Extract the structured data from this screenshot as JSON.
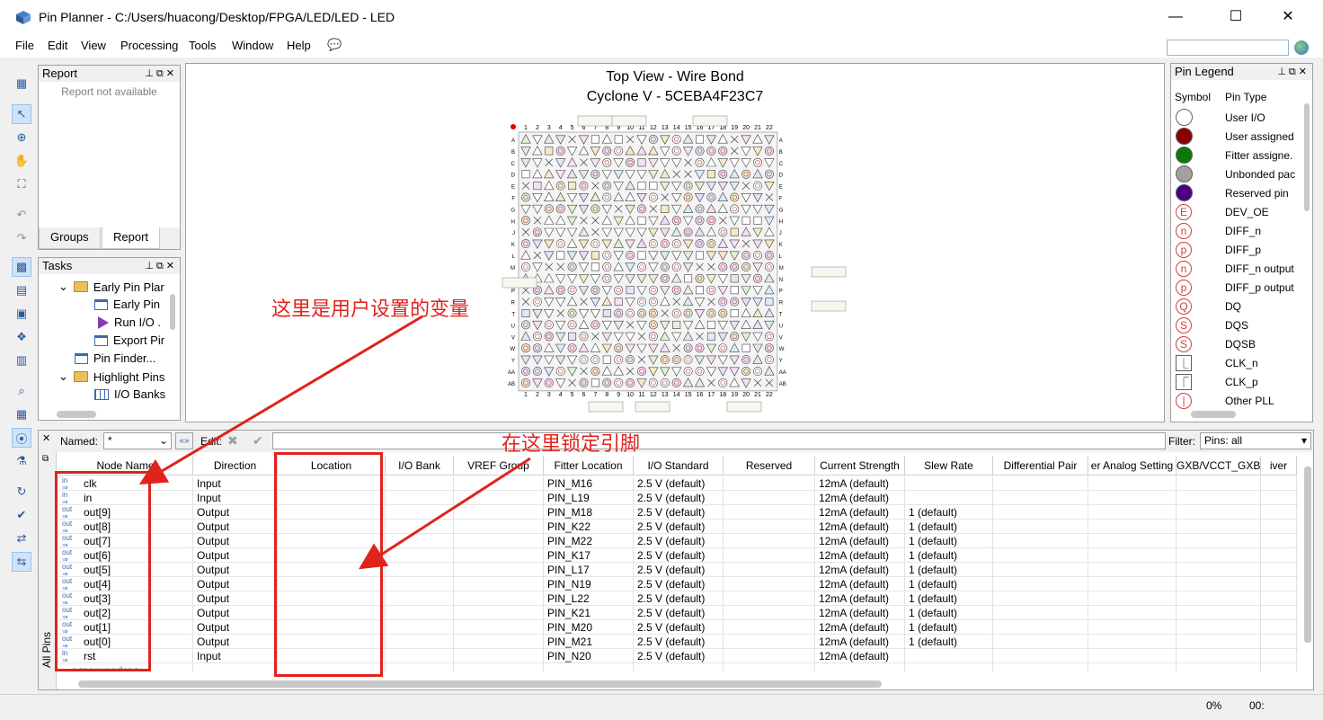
{
  "window": {
    "title": "Pin Planner - C:/Users/huacong/Desktop/FPGA/LED/LED - LED",
    "controls": {
      "minimize": "—",
      "maximize": "☐",
      "close": "✕"
    }
  },
  "menu": [
    "File",
    "Edit",
    "View",
    "Processing",
    "Tools",
    "Window",
    "Help"
  ],
  "report_panel": {
    "title": "Report",
    "message": "Report not available",
    "tabs": [
      "Groups",
      "Report"
    ]
  },
  "tasks_panel": {
    "title": "Tasks",
    "items": [
      "Early Pin Plar",
      "Early Pin",
      "Run I/O .",
      "Export Pir",
      "Pin Finder...",
      "Highlight Pins",
      "I/O Banks"
    ]
  },
  "chip_view": {
    "title_line1": "Top View - Wire Bond",
    "title_line2": "Cyclone V - 5CEBA4F23C7",
    "columns": [
      "1",
      "2",
      "3",
      "4",
      "5",
      "6",
      "7",
      "8",
      "9",
      "10",
      "11",
      "12",
      "13",
      "14",
      "15",
      "16",
      "17",
      "18",
      "19",
      "20",
      "21",
      "22"
    ],
    "rows": [
      "A",
      "B",
      "C",
      "D",
      "E",
      "F",
      "G",
      "H",
      "J",
      "K",
      "L",
      "M",
      "N",
      "P",
      "R",
      "T",
      "U",
      "V",
      "W",
      "Y",
      "AA",
      "AB"
    ]
  },
  "legend": {
    "title": "Pin Legend",
    "col_symbol": "Symbol",
    "col_type": "Pin Type",
    "items": [
      {
        "label": "User I/O",
        "color": "#ffffff",
        "kind": "circle"
      },
      {
        "label": "User assigned",
        "color": "#8b0000",
        "kind": "circle"
      },
      {
        "label": "Fitter assigne.",
        "color": "#0a7a0a",
        "kind": "circle"
      },
      {
        "label": "Unbonded pac",
        "color": "#a0a0a0",
        "kind": "circle"
      },
      {
        "label": "Reserved pin",
        "color": "#4b0082",
        "kind": "circle"
      },
      {
        "label": "DEV_OE",
        "symbol": "E",
        "kind": "letter"
      },
      {
        "label": "DIFF_n",
        "symbol": "n",
        "kind": "letter"
      },
      {
        "label": "DIFF_p",
        "symbol": "p",
        "kind": "letter"
      },
      {
        "label": "DIFF_n output",
        "symbol": "n",
        "kind": "letter"
      },
      {
        "label": "DIFF_p output",
        "symbol": "p",
        "kind": "letter"
      },
      {
        "label": "DQ",
        "symbol": "Q",
        "kind": "letter"
      },
      {
        "label": "DQS",
        "symbol": "S",
        "kind": "letter"
      },
      {
        "label": "DQSB",
        "symbol": "S",
        "kind": "letter"
      },
      {
        "label": "CLK_n",
        "symbol": "⎿",
        "kind": "square"
      },
      {
        "label": "CLK_p",
        "symbol": "⎾",
        "kind": "square"
      },
      {
        "label": "Other PLL",
        "symbol": "|",
        "kind": "letter"
      }
    ]
  },
  "filterbar": {
    "named_label": "Named:",
    "named_value": "*",
    "edit_label": "Edit:",
    "filter_label": "Filter:",
    "filter_value": "Pins: all"
  },
  "side_tab": "All Pins",
  "table": {
    "headers": [
      "Node Name",
      "Direction",
      "Location",
      "I/O Bank",
      "VREF Group",
      "Fitter Location",
      "I/O Standard",
      "Reserved",
      "Current Strength",
      "Slew Rate",
      "Differential Pair",
      "er Analog Setting",
      "GXB/VCCT_GXB",
      "iver"
    ],
    "rows": [
      {
        "dir_icon": "in",
        "name": "clk",
        "direction": "Input",
        "fitter": "PIN_M16",
        "std": "2.5 V (default)",
        "current": "12mA (default)",
        "slew": ""
      },
      {
        "dir_icon": "in",
        "name": "in",
        "direction": "Input",
        "fitter": "PIN_L19",
        "std": "2.5 V (default)",
        "current": "12mA (default)",
        "slew": ""
      },
      {
        "dir_icon": "out",
        "name": "out[9]",
        "direction": "Output",
        "fitter": "PIN_M18",
        "std": "2.5 V (default)",
        "current": "12mA (default)",
        "slew": "1 (default)"
      },
      {
        "dir_icon": "out",
        "name": "out[8]",
        "direction": "Output",
        "fitter": "PIN_K22",
        "std": "2.5 V (default)",
        "current": "12mA (default)",
        "slew": "1 (default)"
      },
      {
        "dir_icon": "out",
        "name": "out[7]",
        "direction": "Output",
        "fitter": "PIN_M22",
        "std": "2.5 V (default)",
        "current": "12mA (default)",
        "slew": "1 (default)"
      },
      {
        "dir_icon": "out",
        "name": "out[6]",
        "direction": "Output",
        "fitter": "PIN_K17",
        "std": "2.5 V (default)",
        "current": "12mA (default)",
        "slew": "1 (default)"
      },
      {
        "dir_icon": "out",
        "name": "out[5]",
        "direction": "Output",
        "fitter": "PIN_L17",
        "std": "2.5 V (default)",
        "current": "12mA (default)",
        "slew": "1 (default)"
      },
      {
        "dir_icon": "out",
        "name": "out[4]",
        "direction": "Output",
        "fitter": "PIN_N19",
        "std": "2.5 V (default)",
        "current": "12mA (default)",
        "slew": "1 (default)"
      },
      {
        "dir_icon": "out",
        "name": "out[3]",
        "direction": "Output",
        "fitter": "PIN_L22",
        "std": "2.5 V (default)",
        "current": "12mA (default)",
        "slew": "1 (default)"
      },
      {
        "dir_icon": "out",
        "name": "out[2]",
        "direction": "Output",
        "fitter": "PIN_K21",
        "std": "2.5 V (default)",
        "current": "12mA (default)",
        "slew": "1 (default)"
      },
      {
        "dir_icon": "out",
        "name": "out[1]",
        "direction": "Output",
        "fitter": "PIN_M20",
        "std": "2.5 V (default)",
        "current": "12mA (default)",
        "slew": "1 (default)"
      },
      {
        "dir_icon": "out",
        "name": "out[0]",
        "direction": "Output",
        "fitter": "PIN_M21",
        "std": "2.5 V (default)",
        "current": "12mA (default)",
        "slew": "1 (default)"
      },
      {
        "dir_icon": "in",
        "name": "rst",
        "direction": "Input",
        "fitter": "PIN_N20",
        "std": "2.5 V (default)",
        "current": "12mA (default)",
        "slew": ""
      }
    ],
    "new_node": "<<new node>>"
  },
  "annotations": {
    "note1": "这里是用户设置的变量",
    "note2": "在这里锁定引脚",
    "color": "#e0231d"
  },
  "status": {
    "progress": "0%",
    "time": "00:"
  }
}
